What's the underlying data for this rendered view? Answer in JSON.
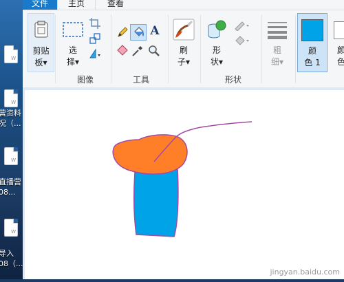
{
  "desktop": {
    "items": [
      {
        "line1": "",
        "line2": ""
      },
      {
        "line1": "营资料",
        "line2": "况（..."
      },
      {
        "line1": "直播营",
        "line2": "08..."
      },
      {
        "line1": "导入",
        "line2": "08（..."
      }
    ]
  },
  "tabs": [
    {
      "label": "文件"
    },
    {
      "label": "主页"
    },
    {
      "label": "查看"
    }
  ],
  "ribbon": {
    "clipboard": {
      "line1": "剪贴",
      "line2": "板▾"
    },
    "select": {
      "line1": "选",
      "line2": "择▾"
    },
    "image_group": "图像",
    "tools_group": "工具",
    "brush": {
      "line1": "刷",
      "line2": "子▾"
    },
    "shapes": {
      "line1": "形",
      "line2": "状▾"
    },
    "shapes_group": "形状",
    "outline": {
      "line1": "粗",
      "line2": "细▾"
    },
    "color1": {
      "line1": "颜",
      "line2": "色 1"
    },
    "color2": {
      "line1": "颜",
      "line2": "色"
    },
    "text_tool": "A"
  },
  "colors": {
    "accent": "#1979ca",
    "color1_swatch": "#00a2e8",
    "cap_fill": "#fe7f27",
    "stem_fill": "#00a2e8",
    "outline": "#a349a4"
  },
  "watermark": "jingyan.baidu.com"
}
